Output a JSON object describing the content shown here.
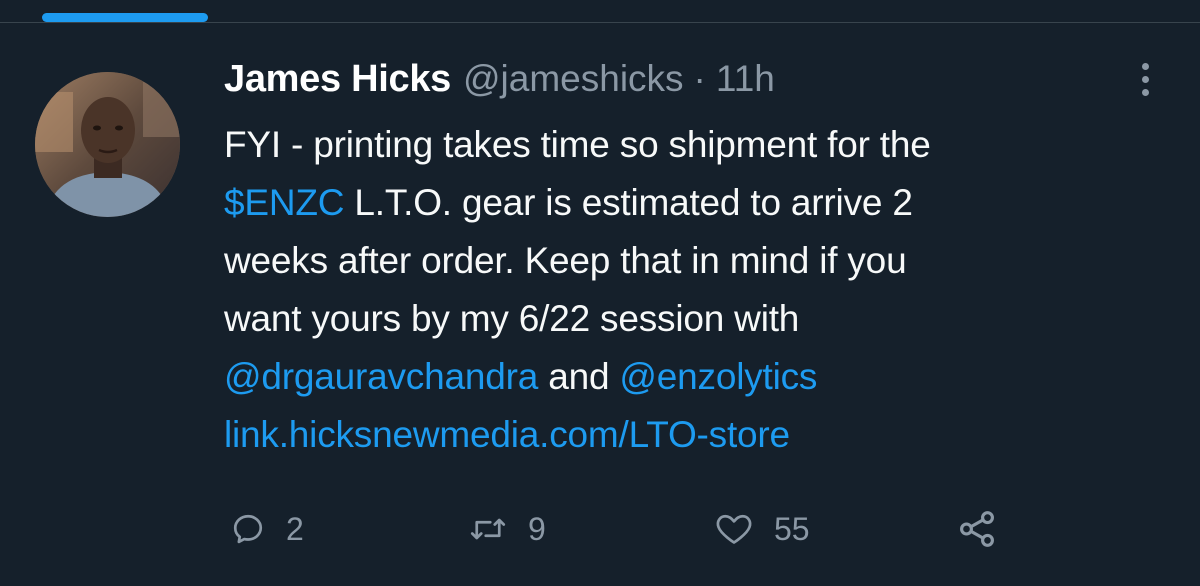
{
  "tweet": {
    "author": {
      "name": "James Hicks",
      "handle": "@jameshicks",
      "avatar_icon": "avatar-photo"
    },
    "separator": "·",
    "timestamp": "11h",
    "text_lines": [
      [
        "FYI - printing takes time so shipment for the"
      ],
      [
        "$ENZC",
        " L.T.O. gear is estimated to arrive 2"
      ],
      [
        "weeks after order. Keep that in mind if you"
      ],
      [
        "want yours by my 6/22 session with"
      ],
      [
        "@drgauravchandra",
        " and ",
        "@enzolytics"
      ],
      [
        "link.hicksnewmedia.com/LTO-store"
      ]
    ],
    "links": {
      "cashtag": "$ENZC",
      "mention_1": "@drgauravchandra",
      "mention_2": "@enzolytics",
      "url": "link.hicksnewmedia.com/LTO-store"
    },
    "plain": {
      "line1": "FYI - printing takes time so shipment for the",
      "line2_rest": " L.T.O. gear is estimated to arrive 2",
      "line3": "weeks after order. Keep that in mind if you",
      "line4": "want yours by my 6/22 session with",
      "line5_and": " and "
    },
    "actions": {
      "replies": "2",
      "retweets": "9",
      "likes": "55"
    }
  },
  "colors": {
    "background": "#15202b",
    "link": "#1d9bf0",
    "muted": "#8b98a5",
    "text": "#f7f9f9"
  },
  "icons": {
    "reply": "reply-icon",
    "retweet": "retweet-icon",
    "like": "heart-icon",
    "share": "share-icon",
    "more": "more-options-icon"
  }
}
